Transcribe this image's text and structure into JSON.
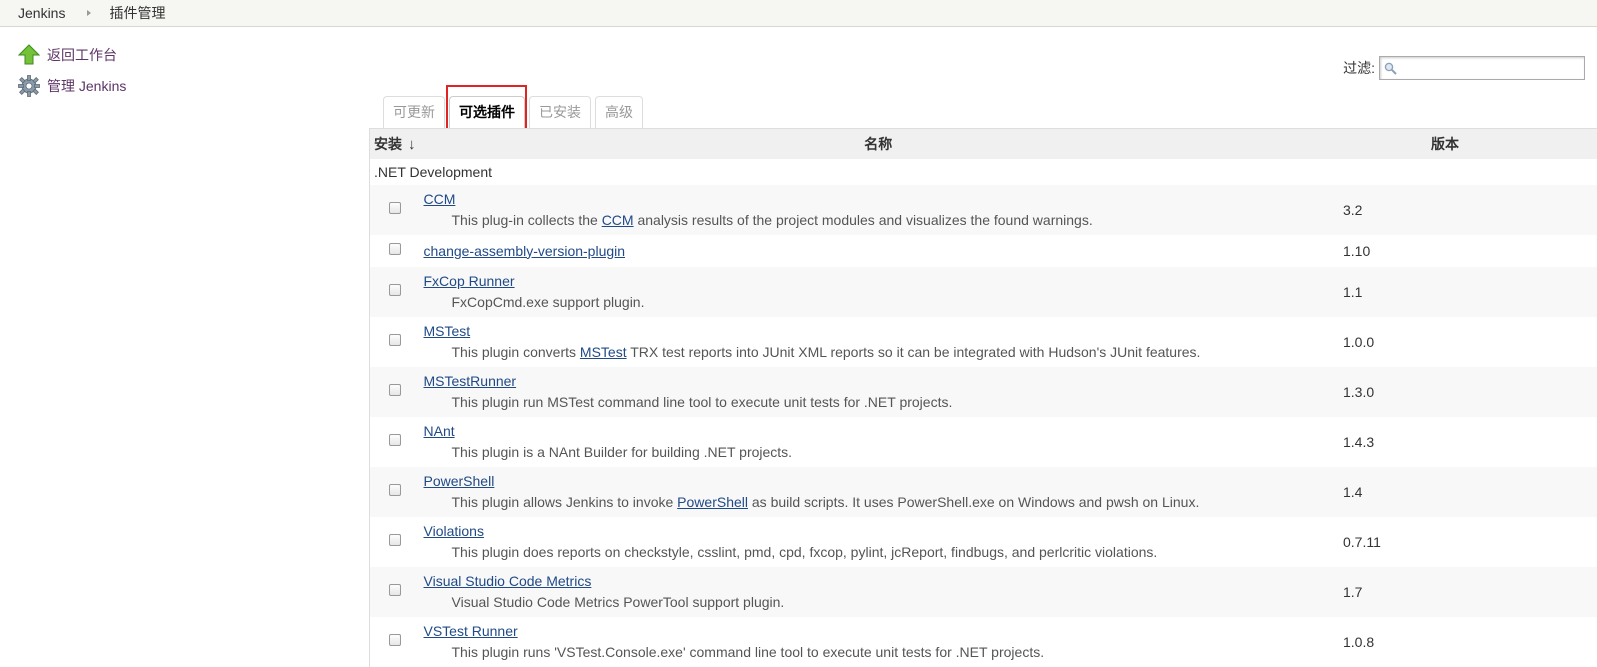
{
  "breadcrumb": {
    "home": "Jenkins",
    "current": "插件管理"
  },
  "sidebar": {
    "items": [
      {
        "label": "返回工作台",
        "icon": "up-arrow-icon"
      },
      {
        "label": "管理 Jenkins",
        "icon": "gear-icon"
      }
    ]
  },
  "filter": {
    "label": "过滤:",
    "value": ""
  },
  "tabs": [
    {
      "label": "可更新",
      "active": false
    },
    {
      "label": "可选插件",
      "active": true
    },
    {
      "label": "已安装",
      "active": false
    },
    {
      "label": "高级",
      "active": false
    }
  ],
  "table": {
    "headers": {
      "install": "安装",
      "sort_indicator": "↓",
      "name": "名称",
      "version": "版本"
    },
    "category": ".NET Development",
    "plugins": [
      {
        "name": "CCM",
        "desc_parts": [
          "This plug-in collects the ",
          "CCM",
          " analysis results of the project modules and visualizes the found warnings."
        ],
        "version": "3.2"
      },
      {
        "name": "change-assembly-version-plugin",
        "desc_parts": [],
        "version": "1.10"
      },
      {
        "name": "FxCop Runner",
        "desc_parts": [
          "FxCopCmd.exe support plugin."
        ],
        "version": "1.1"
      },
      {
        "name": "MSTest",
        "desc_parts": [
          "This plugin converts ",
          "MSTest",
          " TRX test reports into JUnit XML reports so it can be integrated with Hudson's JUnit features."
        ],
        "version": "1.0.0"
      },
      {
        "name": "MSTestRunner",
        "desc_parts": [
          "This plugin run MSTest command line tool to execute unit tests for .NET projects."
        ],
        "version": "1.3.0"
      },
      {
        "name": "NAnt",
        "desc_parts": [
          "This plugin is a NAnt Builder for building .NET projects."
        ],
        "version": "1.4.3"
      },
      {
        "name": "PowerShell",
        "desc_parts": [
          "This plugin allows Jenkins to invoke ",
          "PowerShell",
          " as build scripts. It uses PowerShell.exe on Windows and pwsh on Linux."
        ],
        "version": "1.4"
      },
      {
        "name": "Violations",
        "desc_parts": [
          "This plugin does reports on checkstyle, csslint, pmd, cpd, fxcop, pylint, jcReport, findbugs, and perlcritic violations."
        ],
        "version": "0.7.11"
      },
      {
        "name": "Visual Studio Code Metrics",
        "desc_parts": [
          "Visual Studio Code Metrics PowerTool support plugin."
        ],
        "version": "1.7"
      },
      {
        "name": "VSTest Runner",
        "desc_parts": [
          "This plugin runs 'VSTest.Console.exe' command line tool to execute unit tests for .NET projects."
        ],
        "version": "1.0.8"
      }
    ]
  }
}
